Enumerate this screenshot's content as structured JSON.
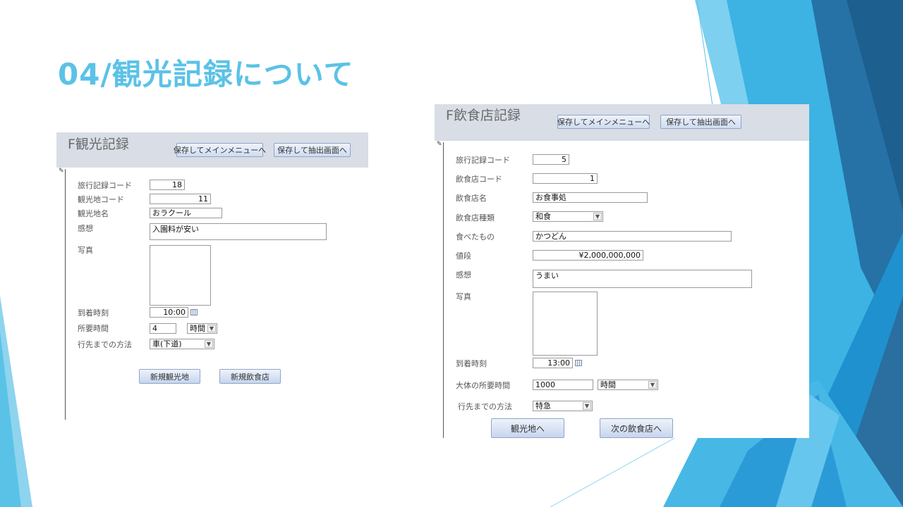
{
  "slide": {
    "title": "04/観光記録について"
  },
  "colors": {
    "accent": "#5bc2e7",
    "header_bg": "#d8dde6"
  },
  "form1": {
    "title": "F観光記録",
    "buttons": {
      "save_main": "保存してメインメニューへ",
      "save_extract": "保存して抽出画面へ"
    },
    "fields": {
      "travel_code": {
        "label": "旅行記録コード",
        "value": "18"
      },
      "spot_code": {
        "label": "観光地コード",
        "value": "11"
      },
      "spot_name": {
        "label": "観光地名",
        "value": "おラクール"
      },
      "impression": {
        "label": "感想",
        "value": "入園料が安い"
      },
      "photo": {
        "label": "写真"
      },
      "arrival_time": {
        "label": "到着時刻",
        "value": "10:00"
      },
      "duration": {
        "label": "所要時間",
        "value": "4",
        "unit": "時間"
      },
      "transport": {
        "label": "行先までの方法",
        "value": "車(下道)"
      }
    },
    "footer_buttons": {
      "new_spot": "新規観光地",
      "new_restaurant": "新規飲食店"
    }
  },
  "form2": {
    "title": "F飲食店記録",
    "buttons": {
      "save_main": "保存してメインメニューへ",
      "save_extract": "保存して抽出画面へ"
    },
    "fields": {
      "travel_code": {
        "label": "旅行記録コード",
        "value": "5"
      },
      "restaurant_code": {
        "label": "飲食店コード",
        "value": "1"
      },
      "restaurant_name": {
        "label": "飲食店名",
        "value": "お食事処"
      },
      "restaurant_type": {
        "label": "飲食店種類",
        "value": "和食"
      },
      "food": {
        "label": "食べたもの",
        "value": "かつどん"
      },
      "price": {
        "label": "値段",
        "value": "¥2,000,000,000"
      },
      "impression": {
        "label": "感想",
        "value": "うまい"
      },
      "photo": {
        "label": "写真"
      },
      "arrival_time": {
        "label": "到着時刻",
        "value": "13:00"
      },
      "duration": {
        "label": "大体の所要時間",
        "value": "1000",
        "unit": "時間"
      },
      "transport": {
        "label": "行先までの方法",
        "value": "特急"
      }
    },
    "footer_buttons": {
      "to_spot": "観光地へ",
      "next_restaurant": "次の飲食店へ"
    }
  }
}
